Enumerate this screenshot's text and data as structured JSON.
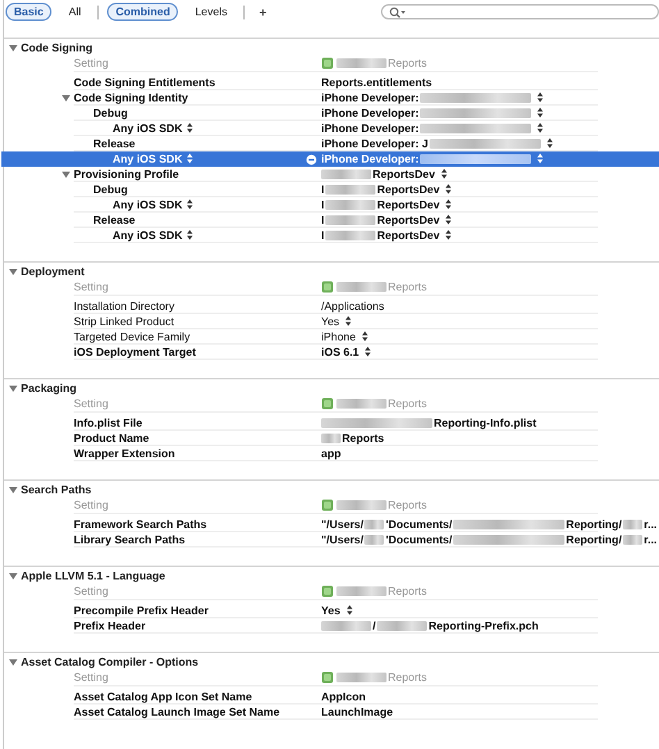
{
  "toolbar": {
    "filters": [
      {
        "label": "Basic",
        "selected": true
      },
      {
        "label": "All",
        "selected": false
      }
    ],
    "views": [
      {
        "label": "Combined",
        "selected": true
      },
      {
        "label": "Levels",
        "selected": false
      }
    ],
    "add_button": "+"
  },
  "search": {
    "has_menu": true
  },
  "sections": [
    {
      "title": "Code Signing",
      "expanded": true,
      "setting": {
        "label": "Setting",
        "target": [
          {
            "kind": "icon"
          },
          {
            "kind": "blur"
          },
          {
            "kind": "text",
            "text": "Reports"
          }
        ]
      },
      "rows": [
        {
          "label": "Code Signing Entitlements",
          "bold": true,
          "selected": false,
          "value": [
            {
              "kind": "text",
              "text": "Reports.entitlements"
            }
          ]
        },
        {
          "label": "Code Signing Identity",
          "bold": true,
          "selected": false,
          "expanded": true,
          "value": [
            {
              "kind": "text",
              "text": "iPhone Developer:"
            },
            {
              "kind": "blur_wide"
            }
          ],
          "popup": true,
          "children": [
            {
              "label": "Debug",
              "bold": true,
              "selected": false,
              "value": [
                {
                  "kind": "text",
                  "text": "iPhone Developer:"
                },
                {
                  "kind": "blur_wide"
                }
              ],
              "popup": true,
              "children": [
                {
                  "label": "Any iOS SDK",
                  "label_popup": true,
                  "bold": true,
                  "selected": false,
                  "value": [
                    {
                      "kind": "text",
                      "text": "iPhone Developer:"
                    },
                    {
                      "kind": "blur_wide"
                    }
                  ],
                  "popup": true
                }
              ]
            },
            {
              "label": "Release",
              "bold": true,
              "selected": false,
              "value": [
                {
                  "kind": "text",
                  "text": "iPhone Developer: J"
                },
                {
                  "kind": "blur_wide"
                }
              ],
              "popup": true,
              "children": [
                {
                  "label": "Any iOS SDK",
                  "label_popup": true,
                  "bold": true,
                  "selected": true,
                  "value": [
                    {
                      "kind": "text",
                      "text": "iPhone Developer:"
                    },
                    {
                      "kind": "blur_wide"
                    }
                  ],
                  "popup": true
                }
              ]
            }
          ]
        },
        {
          "label": "Provisioning Profile",
          "bold": true,
          "selected": false,
          "expanded": true,
          "value": [
            {
              "kind": "blur"
            },
            {
              "kind": "text",
              "text": "ReportsDev"
            }
          ],
          "popup": true,
          "children": [
            {
              "label": "Debug",
              "bold": true,
              "selected": false,
              "value": [
                {
                  "kind": "text",
                  "text": "I"
                },
                {
                  "kind": "blur"
                },
                {
                  "kind": "text",
                  "text": "ReportsDev"
                }
              ],
              "popup": true,
              "children": [
                {
                  "label": "Any iOS SDK",
                  "label_popup": true,
                  "bold": true,
                  "selected": false,
                  "value": [
                    {
                      "kind": "text",
                      "text": "I"
                    },
                    {
                      "kind": "blur"
                    },
                    {
                      "kind": "text",
                      "text": "ReportsDev"
                    }
                  ],
                  "popup": true
                }
              ]
            },
            {
              "label": "Release",
              "bold": true,
              "selected": false,
              "value": [
                {
                  "kind": "text",
                  "text": "I"
                },
                {
                  "kind": "blur"
                },
                {
                  "kind": "text",
                  "text": "ReportsDev"
                }
              ],
              "popup": true,
              "children": [
                {
                  "label": "Any iOS SDK",
                  "label_popup": true,
                  "bold": true,
                  "selected": false,
                  "value": [
                    {
                      "kind": "text",
                      "text": "I"
                    },
                    {
                      "kind": "blur"
                    },
                    {
                      "kind": "text",
                      "text": "ReportsDev"
                    }
                  ],
                  "popup": true
                }
              ]
            }
          ]
        }
      ]
    },
    {
      "title": "Deployment",
      "expanded": true,
      "setting": {
        "label": "Setting",
        "target": [
          {
            "kind": "icon"
          },
          {
            "kind": "blur"
          },
          {
            "kind": "text",
            "text": "Reports"
          }
        ]
      },
      "rows": [
        {
          "label": "Installation Directory",
          "bold": false,
          "selected": false,
          "value": [
            {
              "kind": "text",
              "text": "/Applications"
            }
          ]
        },
        {
          "label": "Strip Linked Product",
          "bold": false,
          "selected": false,
          "value": [
            {
              "kind": "text",
              "text": "Yes"
            }
          ],
          "popup": true
        },
        {
          "label": "Targeted Device Family",
          "bold": false,
          "selected": false,
          "value": [
            {
              "kind": "text",
              "text": "iPhone"
            }
          ],
          "popup": true
        },
        {
          "label": "iOS Deployment Target",
          "bold": true,
          "selected": false,
          "value": [
            {
              "kind": "text",
              "text": "iOS 6.1"
            }
          ],
          "popup": true
        }
      ]
    },
    {
      "title": "Packaging",
      "expanded": true,
      "setting": {
        "label": "Setting",
        "target": [
          {
            "kind": "icon"
          },
          {
            "kind": "blur"
          },
          {
            "kind": "text",
            "text": "Reports"
          }
        ]
      },
      "rows": [
        {
          "label": "Info.plist File",
          "bold": true,
          "selected": false,
          "value": [
            {
              "kind": "blur_wide"
            },
            {
              "kind": "text",
              "text": "Reporting-Info.plist"
            }
          ]
        },
        {
          "label": "Product Name",
          "bold": true,
          "selected": false,
          "value": [
            {
              "kind": "blur_narrow"
            },
            {
              "kind": "text",
              "text": "Reports"
            }
          ]
        },
        {
          "label": "Wrapper Extension",
          "bold": true,
          "selected": false,
          "value": [
            {
              "kind": "text",
              "text": "app"
            }
          ]
        }
      ]
    },
    {
      "title": "Search Paths",
      "expanded": true,
      "setting": {
        "label": "Setting",
        "target": [
          {
            "kind": "icon"
          },
          {
            "kind": "blur"
          },
          {
            "kind": "text",
            "text": "Reports"
          }
        ]
      },
      "rows": [
        {
          "label": "Framework Search Paths",
          "bold": true,
          "selected": false,
          "value": [
            {
              "kind": "text",
              "text": "\"/Users/"
            },
            {
              "kind": "blur_narrow"
            },
            {
              "kind": "text",
              "text": "'Documents/"
            },
            {
              "kind": "blur_wide"
            },
            {
              "kind": "text",
              "text": "Reporting/"
            },
            {
              "kind": "blur_narrow"
            },
            {
              "kind": "text",
              "text": "r..."
            }
          ]
        },
        {
          "label": "Library Search Paths",
          "bold": true,
          "selected": false,
          "value": [
            {
              "kind": "text",
              "text": "\"/Users/"
            },
            {
              "kind": "blur_narrow"
            },
            {
              "kind": "text",
              "text": "'Documents/"
            },
            {
              "kind": "blur_wide"
            },
            {
              "kind": "text",
              "text": "Reporting/"
            },
            {
              "kind": "blur_narrow"
            },
            {
              "kind": "text",
              "text": "r..."
            }
          ]
        }
      ]
    },
    {
      "title": "Apple LLVM 5.1 - Language",
      "expanded": true,
      "setting": {
        "label": "Setting",
        "target": [
          {
            "kind": "icon"
          },
          {
            "kind": "blur"
          },
          {
            "kind": "text",
            "text": "Reports"
          }
        ]
      },
      "rows": [
        {
          "label": "Precompile Prefix Header",
          "bold": true,
          "selected": false,
          "value": [
            {
              "kind": "text",
              "text": "Yes"
            }
          ],
          "popup": true
        },
        {
          "label": "Prefix Header",
          "bold": true,
          "selected": false,
          "value": [
            {
              "kind": "blur"
            },
            {
              "kind": "text",
              "text": "/"
            },
            {
              "kind": "blur"
            },
            {
              "kind": "text",
              "text": "Reporting-Prefix.pch"
            }
          ]
        }
      ]
    },
    {
      "title": "Asset Catalog Compiler - Options",
      "expanded": true,
      "setting": {
        "label": "Setting",
        "target": [
          {
            "kind": "icon"
          },
          {
            "kind": "blur"
          },
          {
            "kind": "text",
            "text": "Reports"
          }
        ]
      },
      "rows": [
        {
          "label": "Asset Catalog App Icon Set Name",
          "bold": true,
          "selected": false,
          "value": [
            {
              "kind": "text",
              "text": "AppIcon"
            }
          ]
        },
        {
          "label": "Asset Catalog Launch Image Set Name",
          "bold": true,
          "selected": false,
          "value": [
            {
              "kind": "text",
              "text": "LaunchImage"
            }
          ]
        }
      ]
    }
  ]
}
